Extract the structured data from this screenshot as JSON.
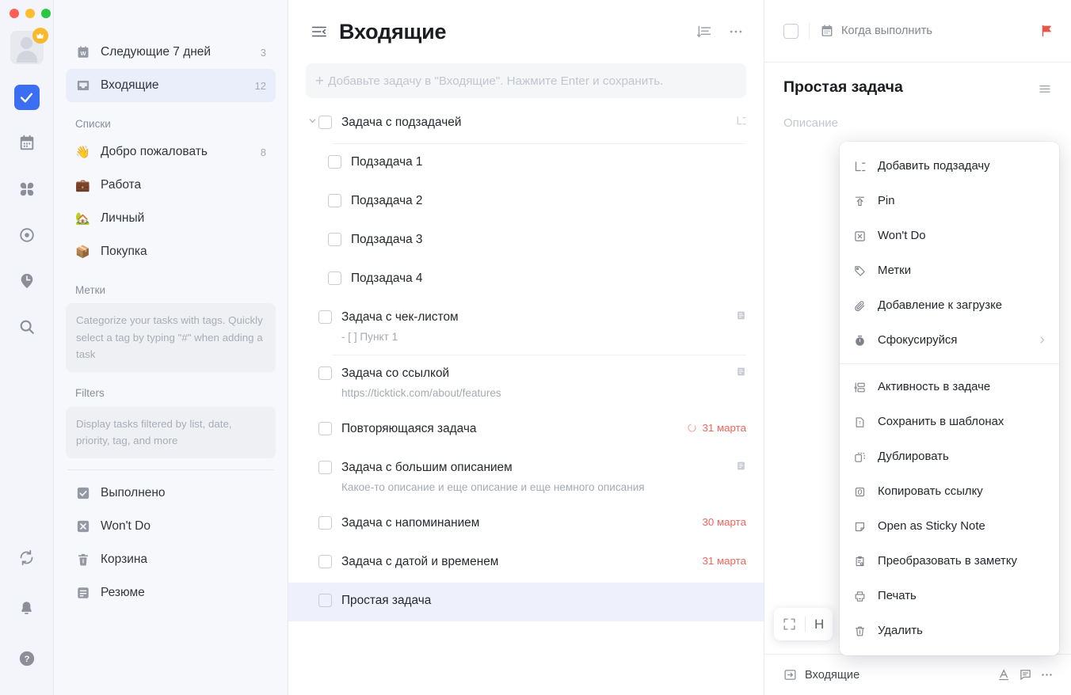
{
  "window": {
    "traffic_lights": [
      "close",
      "minimize",
      "zoom"
    ],
    "accent_color": "#3b6ef3",
    "due_color": "#f2655a"
  },
  "rail": {
    "avatar_badge": "crown",
    "items": [
      {
        "name": "tasks",
        "icon": "check-square-icon",
        "active": true
      },
      {
        "name": "calendar",
        "icon": "calendar-icon",
        "active": false
      },
      {
        "name": "matrix",
        "icon": "grid-clover-icon",
        "active": false
      },
      {
        "name": "habit",
        "icon": "target-icon",
        "active": false
      },
      {
        "name": "pomodoro",
        "icon": "clock-pin-icon",
        "active": false
      },
      {
        "name": "search",
        "icon": "search-icon",
        "active": false
      }
    ],
    "bottom_items": [
      {
        "name": "sync",
        "icon": "sync-icon"
      },
      {
        "name": "notifications",
        "icon": "bell-icon"
      },
      {
        "name": "help",
        "icon": "help-circle-icon"
      }
    ]
  },
  "sidebar": {
    "smart_lists": [
      {
        "label": "Следующие 7 дней",
        "count": "3",
        "icon": "week-calendar-icon",
        "selected": false
      },
      {
        "label": "Входящие",
        "count": "12",
        "icon": "inbox-icon",
        "selected": true
      }
    ],
    "lists_heading": "Списки",
    "lists": [
      {
        "label": "Добро пожаловать",
        "count": "8",
        "emoji": "👋"
      },
      {
        "label": "Работа",
        "count": "",
        "emoji": "💼"
      },
      {
        "label": "Личный",
        "count": "",
        "emoji": "🏡"
      },
      {
        "label": "Покупка",
        "count": "",
        "emoji": "📦"
      }
    ],
    "tags_heading": "Метки",
    "tags_hint": "Categorize your tasks with tags. Quickly select a tag by typing \"#\" when adding a task",
    "filters_heading": "Filters",
    "filters_hint": "Display tasks filtered by list, date, priority, tag, and more",
    "bottom_items": [
      {
        "label": "Выполнено",
        "icon": "check-box-icon"
      },
      {
        "label": "Won't Do",
        "icon": "x-box-icon"
      },
      {
        "label": "Корзина",
        "icon": "trash-icon"
      },
      {
        "label": "Резюме",
        "icon": "summary-icon"
      }
    ]
  },
  "main": {
    "title": "Входящие",
    "collapse_icon": "collapse-sidebar-icon",
    "sort_icon": "sort-icon",
    "more_icon": "more-horizontal-icon",
    "add_task_placeholder": "Добавьте задачу в \"Входящие\". Нажмите Enter и сохранить.",
    "tasks": [
      {
        "title": "Задача с подзадачей",
        "sub": "",
        "date": "",
        "icon": "subtask-icon",
        "chevron": true,
        "indent": false,
        "selected": false,
        "recurring": false
      },
      {
        "title": "Подзадача 1",
        "sub": "",
        "date": "",
        "icon": "",
        "chevron": false,
        "indent": true,
        "selected": false,
        "recurring": false
      },
      {
        "title": "Подзадача 2",
        "sub": "",
        "date": "",
        "icon": "",
        "chevron": false,
        "indent": true,
        "selected": false,
        "recurring": false
      },
      {
        "title": "Подзадача 3",
        "sub": "",
        "date": "",
        "icon": "",
        "chevron": false,
        "indent": true,
        "selected": false,
        "recurring": false
      },
      {
        "title": "Подзадача 4",
        "sub": "",
        "date": "",
        "icon": "",
        "chevron": false,
        "indent": true,
        "selected": false,
        "recurring": false
      },
      {
        "title": "Задача с чек-листом",
        "sub": "- [ ] Пункт 1",
        "date": "",
        "icon": "note-icon",
        "chevron": false,
        "indent": false,
        "selected": false,
        "recurring": false
      },
      {
        "title": "Задача со ссылкой",
        "sub": "https://ticktick.com/about/features",
        "date": "",
        "icon": "note-icon",
        "chevron": false,
        "indent": false,
        "selected": false,
        "recurring": false
      },
      {
        "title": "Повторяющаяся задача",
        "sub": "",
        "date": "31 марта",
        "icon": "",
        "chevron": false,
        "indent": false,
        "selected": false,
        "recurring": true
      },
      {
        "title": "Задача с большим описанием",
        "sub": "Какое-то описание и еще описание и еще немного описания",
        "date": "",
        "icon": "note-icon",
        "chevron": false,
        "indent": false,
        "selected": false,
        "recurring": false
      },
      {
        "title": "Задача с напоминанием",
        "sub": "",
        "date": "30 марта",
        "icon": "",
        "chevron": false,
        "indent": false,
        "selected": false,
        "recurring": false
      },
      {
        "title": "Задача с датой и временем",
        "sub": "",
        "date": "31 марта",
        "icon": "",
        "chevron": false,
        "indent": false,
        "selected": false,
        "recurring": false
      },
      {
        "title": "Простая задача",
        "sub": "",
        "date": "",
        "icon": "",
        "chevron": false,
        "indent": false,
        "selected": true,
        "recurring": false
      }
    ]
  },
  "detail": {
    "due_label": "Когда выполнить",
    "due_icon": "calendar-icon",
    "flag_icon": "flag-icon",
    "title": "Простая задача",
    "menu_icon": "hamburger-icon",
    "description_placeholder": "Описание",
    "float_toolbar": {
      "expand_icon": "expand-icon",
      "heading_label": "H"
    },
    "footer": {
      "list_label": "Входящие",
      "list_icon": "move-to-icon",
      "format_icon": "font-format-icon",
      "comment_icon": "comment-icon",
      "more_icon": "more-horizontal-icon"
    }
  },
  "context_menu": {
    "groups": [
      [
        {
          "label": "Добавить подзадачу",
          "icon": "subtask-icon",
          "submenu": false
        },
        {
          "label": "Pin",
          "icon": "pin-arrow-icon",
          "submenu": false
        },
        {
          "label": "Won't Do",
          "icon": "x-box-icon",
          "submenu": false
        },
        {
          "label": "Метки",
          "icon": "tag-icon",
          "submenu": false
        },
        {
          "label": "Добавление к загрузке",
          "icon": "paperclip-icon",
          "submenu": false
        },
        {
          "label": "Сфокусируйся",
          "icon": "pomodoro-icon",
          "submenu": true
        }
      ],
      [
        {
          "label": "Активность в задаче",
          "icon": "activity-icon",
          "submenu": false
        },
        {
          "label": "Сохранить в шаблонах",
          "icon": "template-icon",
          "submenu": false
        },
        {
          "label": "Дублировать",
          "icon": "duplicate-icon",
          "submenu": false
        },
        {
          "label": "Копировать ссылку",
          "icon": "copy-link-icon",
          "submenu": false
        },
        {
          "label": "Open as Sticky Note",
          "icon": "sticky-note-icon",
          "submenu": false
        },
        {
          "label": "Преобразовать в заметку",
          "icon": "convert-note-icon",
          "submenu": false
        },
        {
          "label": "Печать",
          "icon": "printer-icon",
          "submenu": false
        },
        {
          "label": "Удалить",
          "icon": "trash-icon",
          "submenu": false
        }
      ]
    ]
  }
}
